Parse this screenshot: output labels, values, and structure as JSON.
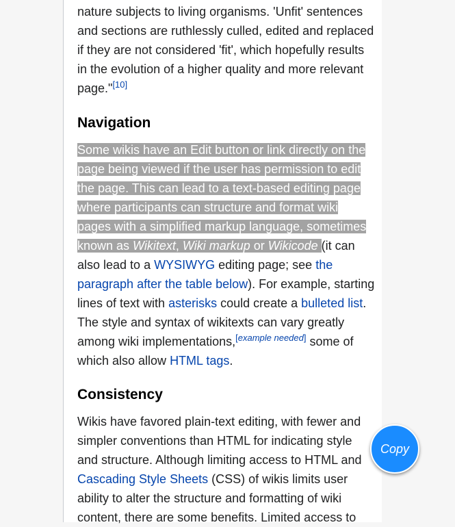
{
  "top_paragraph": {
    "text": "nature subjects to living organisms. 'Unfit' sentences and sections are ruthlessly culled, edited and replaced if they are not considered 'fit', which hopefully results in the evolution of a higher quality and more relevant page.\"",
    "ref": "[10]"
  },
  "navigation": {
    "heading": "Navigation",
    "highlighted_text": "Some wikis have an Edit button or link directly on the page being viewed if the user has permission to edit the page. This can lead to a text-based editing page where participants can structure and format wiki pages with a simplified markup language, sometimes known as ",
    "term_wikitext": "Wikitext",
    "sep1": ", ",
    "term_wiki_markup": "Wiki markup",
    "sep2": " or ",
    "term_wikicode": "Wikicode",
    "text_after_1": " (it can also lead to a ",
    "link_wysiwyg": "WYSIWYG",
    "text_after_2": " editing page; see ",
    "link_paragraph": "the paragraph after the table below",
    "text_after_3": "). For example, starting lines of text with ",
    "link_asterisks": "asterisks",
    "text_after_4": " could create a ",
    "link_bulleted": "bulleted list",
    "text_after_5": ". The style and syntax of wikitexts can vary greatly among wiki implementations,",
    "note_open": "[",
    "note_example": "example needed",
    "note_close": "]",
    "text_after_6": " some of which also allow ",
    "link_html_tags": "HTML tags",
    "text_after_7": "."
  },
  "consistency": {
    "heading": "Consistency",
    "text_1": "Wikis have favored plain-text editing, with fewer and simpler conventions than HTML for indicating style and structure. Although limiting access to HTML and ",
    "link_css": "Cascading Style Sheets",
    "text_2": " (CSS) of wikis limits user ability to alter the structure and formatting of wiki content, there are some benefits. Limited access to"
  },
  "copy_button": {
    "label": "Copy"
  }
}
